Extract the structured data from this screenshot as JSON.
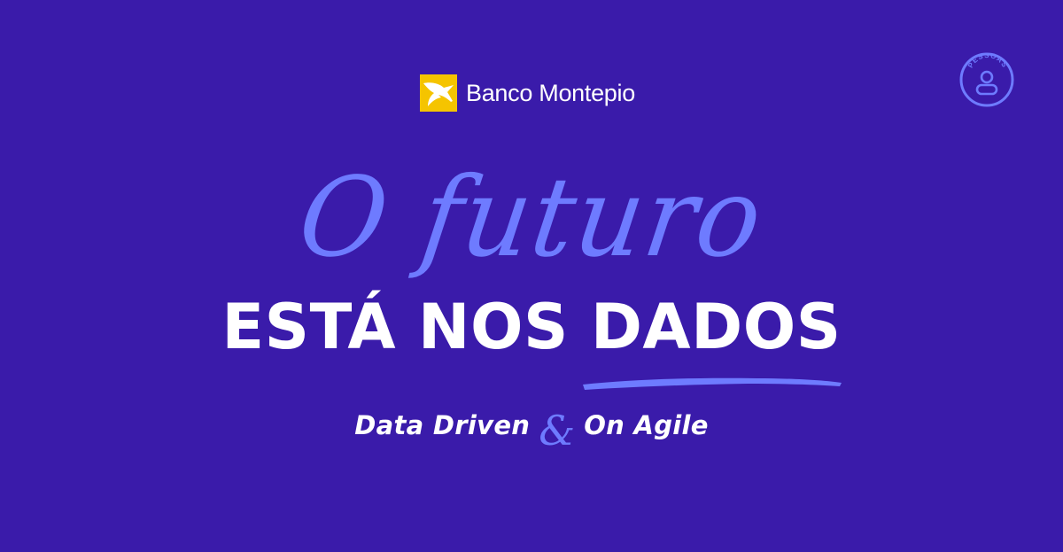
{
  "brand": {
    "name": "Banco Montepio",
    "logo_color": "#f5c400",
    "icon": "pelican-logo-icon"
  },
  "badge": {
    "label": "PESSOAS",
    "icon": "person-icon",
    "color": "#6e7bff"
  },
  "headline": {
    "script": "O futuro",
    "line1": "ESTÁ NOS",
    "line2": "DADOS"
  },
  "subtitle": {
    "left": "Data Driven",
    "ampersand": "&",
    "right": "On Agile"
  },
  "colors": {
    "background": "#3a1baa",
    "accent": "#6e7bff",
    "text": "#ffffff"
  }
}
